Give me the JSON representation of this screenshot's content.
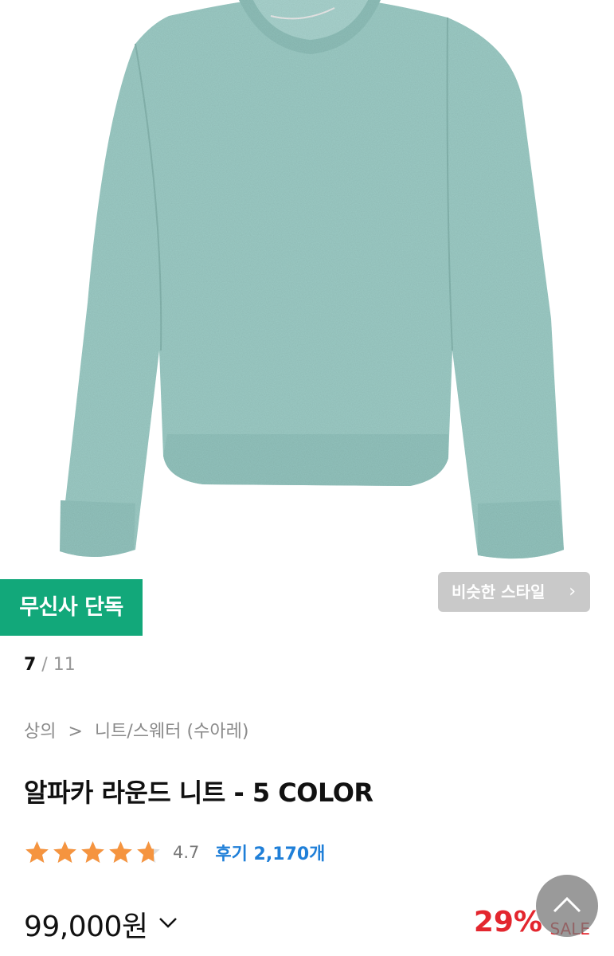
{
  "product_image": {
    "icon": "sweater-image",
    "color": "#9ccbc5"
  },
  "badge": {
    "label": "무신사 단독",
    "color": "#12a87a"
  },
  "similar_style": {
    "label": "비슷한 스타일",
    "icon": "chevron-right-icon"
  },
  "pager": {
    "current": "7",
    "separator": " / ",
    "total": "11"
  },
  "breadcrumb": {
    "items": [
      "상의",
      "니트/스웨터 (수아레)"
    ],
    "separator": ">"
  },
  "product": {
    "title": "알파카 라운드 니트 - 5 COLOR",
    "rating": 4.7,
    "rating_text": "4.7",
    "stars_total": 5,
    "reviews": "후기 2,170개",
    "price": "99,000원",
    "discount": "29%",
    "sale_label": "SALE"
  },
  "colors": {
    "star": "#f5943f",
    "review_link": "#1f7fd8",
    "discount": "#e3262e"
  },
  "scroll_top": {
    "icon": "chevron-up-icon"
  }
}
